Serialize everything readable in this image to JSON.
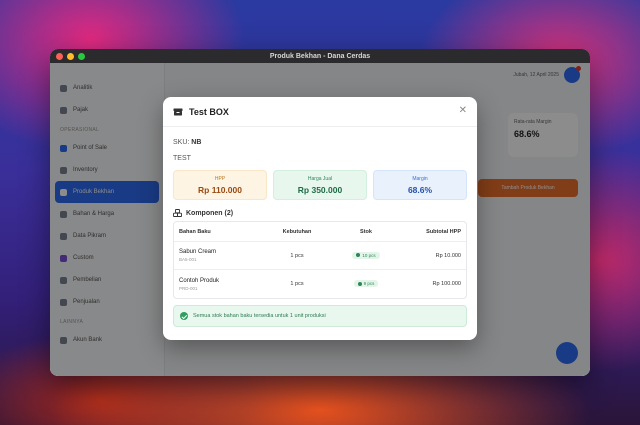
{
  "window": {
    "title": "Produk Bekhan - Dana Cerdas"
  },
  "sidebar": {
    "items": [
      {
        "label": "Analitik",
        "icon": "home-icon"
      },
      {
        "label": "Pajak",
        "icon": "receipt-icon"
      }
    ],
    "section": "OPERASIONAL",
    "items2": [
      {
        "label": "Point of Sale",
        "icon": "cart-icon"
      },
      {
        "label": "Inventory",
        "icon": "box-icon"
      },
      {
        "label": "Produk Bekhan",
        "icon": "package-icon",
        "active": true
      },
      {
        "label": "Bahan & Harga",
        "icon": "tag-icon"
      },
      {
        "label": "Data Pikram",
        "icon": "doc-icon"
      },
      {
        "label": "Custom",
        "icon": "folder-icon"
      },
      {
        "label": "Pembelian",
        "icon": "truck-icon"
      },
      {
        "label": "Penjualan",
        "icon": "chart-icon"
      }
    ],
    "section2": "LAINNYA",
    "items3": [
      {
        "label": "Akun Bank",
        "icon": "bank-icon"
      }
    ]
  },
  "header": {
    "user_text": "Jubah, 12 April 2025"
  },
  "stat": {
    "label": "Rata-rata Margin",
    "value": "68.6%"
  },
  "action_button": "Tambah Produk Bekhan",
  "modal": {
    "title": "Test BOX",
    "sku_label": "SKU:",
    "sku_value": "NB",
    "description": "TEST",
    "metrics": [
      {
        "label": "HPP",
        "value": "Rp 110.000"
      },
      {
        "label": "Harga Jual",
        "value": "Rp 350.000"
      },
      {
        "label": "Margin",
        "value": "68.6%"
      }
    ],
    "components_title": "Komponen (2)",
    "table": {
      "headers": [
        "Bahan Baku",
        "Kebutuhan",
        "Stok",
        "Subtotal HPP"
      ],
      "rows": [
        {
          "name": "Sabun Cream",
          "code": "BA5-001",
          "need": "1 pcs",
          "stock": "10 pcs",
          "subtotal": "Rp 10.000"
        },
        {
          "name": "Contoh Produk",
          "code": "PRD-001",
          "need": "1 pcs",
          "stock": "9 pcs",
          "subtotal": "Rp 100.000"
        }
      ]
    },
    "alert": "Semua stok bahan baku tersedia untuk 1 unit produksi"
  }
}
